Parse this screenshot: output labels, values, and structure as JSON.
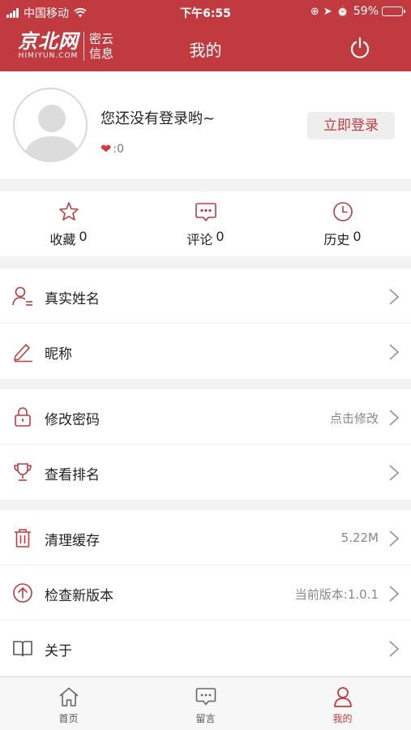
{
  "status_bar": {
    "carrier": "中国移动",
    "time": "下午6:55",
    "battery": "59%",
    "battery_level": 0.59
  },
  "header": {
    "logo_main": "京北网",
    "logo_domain": "HIMIYUN.COM",
    "logo_sub": "密云信息",
    "title": "我的",
    "power_icon": "power-icon"
  },
  "profile": {
    "hint": "您还没有登录哟~",
    "likes_text": ":0",
    "login_button": "立即登录"
  },
  "stats": [
    {
      "label": "收藏",
      "count": "0",
      "icon": "star-icon"
    },
    {
      "label": "评论",
      "count": "0",
      "icon": "comment-icon"
    },
    {
      "label": "历史",
      "count": "0",
      "icon": "clock-icon"
    }
  ],
  "settings": {
    "group1": [
      {
        "label": "真实姓名",
        "value": "",
        "icon": "user-icon"
      },
      {
        "label": "昵称",
        "value": "",
        "icon": "pencil-icon"
      }
    ],
    "group2": [
      {
        "label": "修改密码",
        "value": "点击修改",
        "icon": "lock-icon"
      },
      {
        "label": "查看排名",
        "value": "",
        "icon": "trophy-icon"
      }
    ],
    "group3": [
      {
        "label": "清理缓存",
        "value": "5.22M",
        "icon": "trash-icon"
      },
      {
        "label": "检查新版本",
        "value": "当前版本:1.0.1",
        "icon": "upload-icon"
      },
      {
        "label": "关于",
        "value": "",
        "icon": "book-icon"
      }
    ]
  },
  "tabbar": [
    {
      "label": "首页",
      "icon": "home-icon",
      "active": false
    },
    {
      "label": "留言",
      "icon": "message-icon",
      "active": false
    },
    {
      "label": "我的",
      "icon": "person-icon",
      "active": true
    }
  ],
  "colors": {
    "brand": "#c13a3f",
    "background": "#f2f2f2",
    "muted_text": "#888888"
  }
}
